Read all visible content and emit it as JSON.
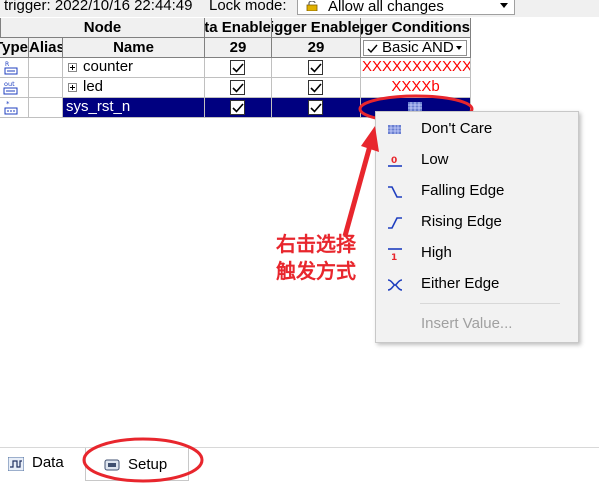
{
  "toolbar": {
    "trigger_label": "trigger: 2022/10/16 22:44:49",
    "lock_mode_label": "Lock mode:",
    "lock_mode_value": "Allow all changes"
  },
  "table": {
    "group_headers": {
      "node": "Node",
      "data_enable": "Data Enable",
      "trigger_enable": "Trigger Enable",
      "trigger_conditions": "Trigger Conditions"
    },
    "column_headers": {
      "type": "Type",
      "alias": "Alias",
      "name": "Name",
      "data_enable_count": "29",
      "trigger_enable_count": "29",
      "trigger_condition_mode": "Basic AND"
    },
    "rows": [
      {
        "type_icon": "register-icon",
        "name": "counter",
        "data_enable": true,
        "trigger_enable": true,
        "condition": "XXXXXXXXXXXXXXXXXXXXXXXXXXXXXh"
      },
      {
        "type_icon": "output-pin-icon",
        "name": "led",
        "data_enable": true,
        "trigger_enable": true,
        "condition": "XXXXb"
      },
      {
        "type_icon": "input-pin-icon",
        "name": "sys_rst_n",
        "data_enable": true,
        "trigger_enable": true,
        "condition": ""
      }
    ]
  },
  "context_menu": {
    "items": [
      {
        "label": "Don't Care",
        "icon": "dont-care-icon"
      },
      {
        "label": "Low",
        "icon": "low-icon"
      },
      {
        "label": "Falling Edge",
        "icon": "falling-edge-icon"
      },
      {
        "label": "Rising Edge",
        "icon": "rising-edge-icon"
      },
      {
        "label": "High",
        "icon": "high-icon"
      },
      {
        "label": "Either Edge",
        "icon": "either-edge-icon"
      }
    ],
    "insert_value": "Insert Value..."
  },
  "annotation": {
    "line1": "右击选择",
    "line2": "触发方式",
    "color": "#e8262d"
  },
  "tabs": {
    "data": "Data",
    "setup": "Setup"
  },
  "colors": {
    "selection": "#000080",
    "condition_text": "#ff0000",
    "annotation": "#e8262d",
    "menu_icon_blue": "#1f3fbf"
  }
}
